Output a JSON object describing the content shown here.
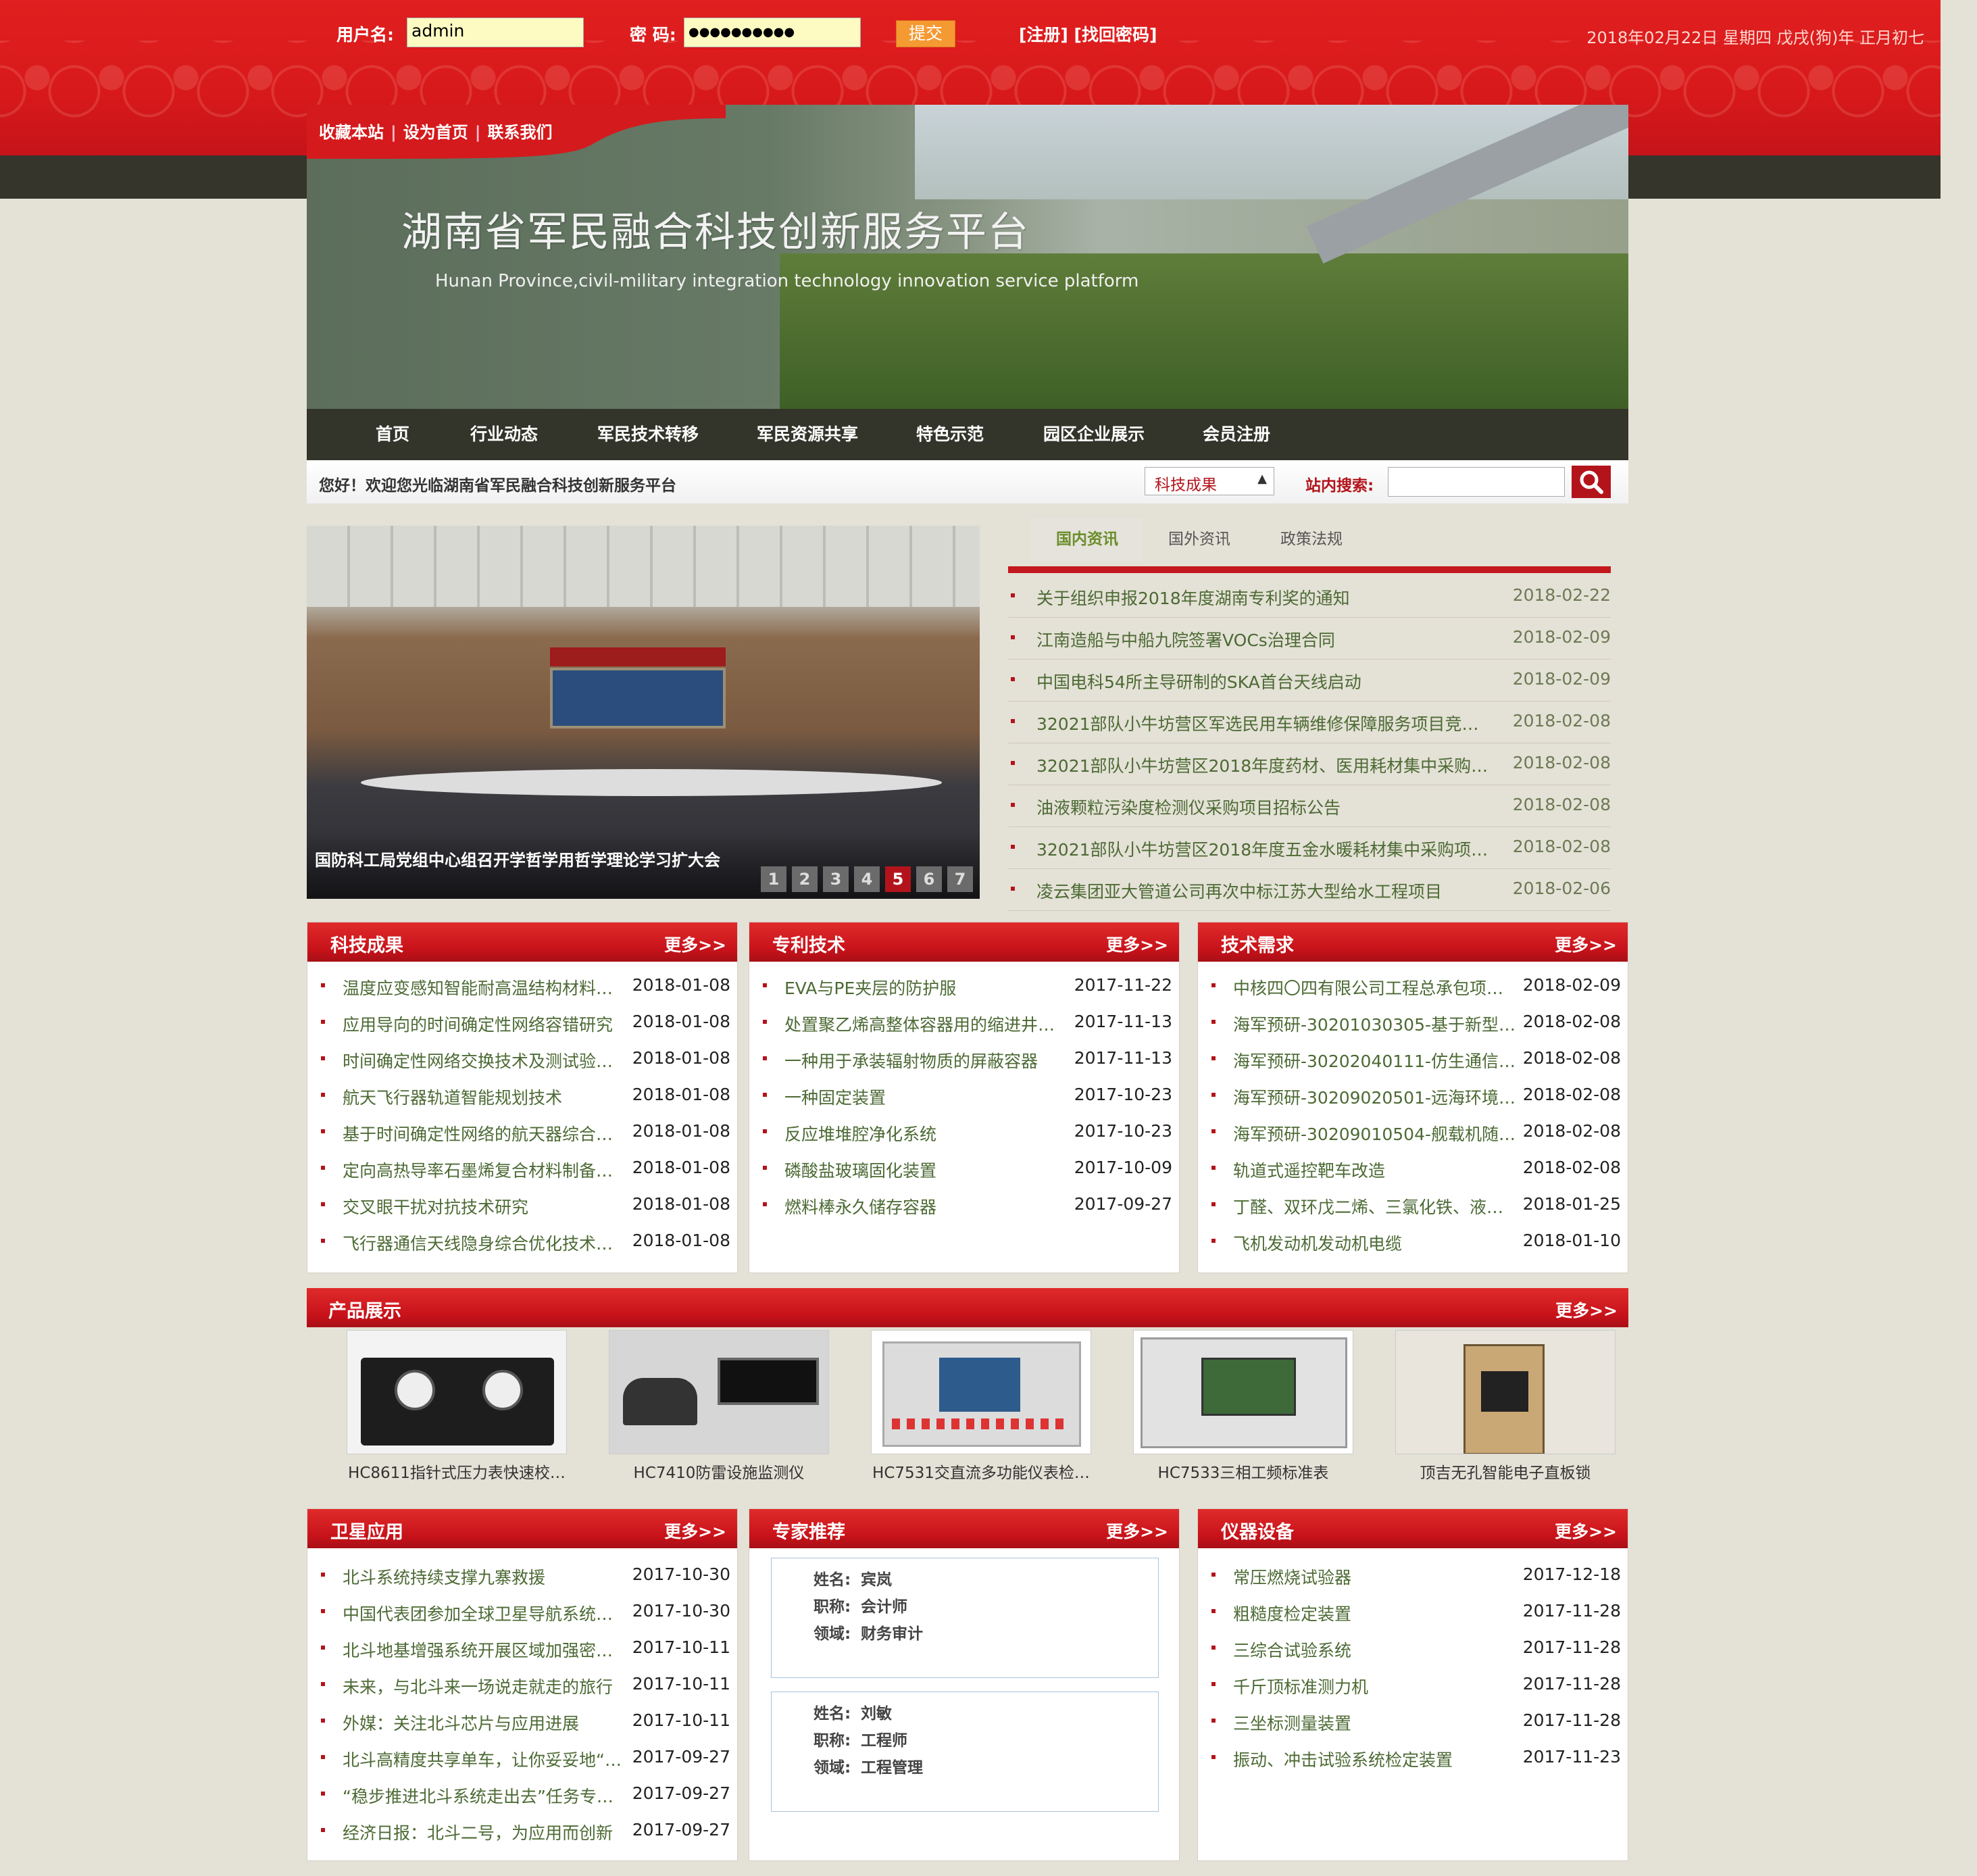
{
  "login": {
    "username_label": "用户名:",
    "username_value": "admin",
    "password_label": "密 码:",
    "password_value": "●●●●●●●●●●",
    "submit_label": "提交",
    "links": "[注册] [找回密码]",
    "date": "2018年02月22日 星期四 戊戌(狗)年 正月初七"
  },
  "toplinks": [
    "收藏本站",
    "设为首页",
    "联系我们"
  ],
  "banner": {
    "title": "湖南省军民融合科技创新服务平台",
    "subtitle": "Hunan Province,civil-military integration technology innovation service platform"
  },
  "nav": [
    "首页",
    "行业动态",
    "军民技术转移",
    "军民资源共享",
    "特色示范",
    "园区企业展示",
    "会员注册"
  ],
  "welcome": {
    "text": "您好！欢迎您光临湖南省军民融合科技创新服务平台",
    "select_value": "科技成果",
    "search_label": "站内搜索:"
  },
  "slideshow": {
    "caption": "国防科工局党组中心组召开学哲学用哲学理论学习扩大会",
    "pages": [
      "1",
      "2",
      "3",
      "4",
      "5",
      "6",
      "7"
    ],
    "active": 5
  },
  "news_tabs": [
    "国内资讯",
    "国外资讯",
    "政策法规"
  ],
  "news": [
    {
      "title": "关于组织申报2018年度湖南专利奖的通知",
      "date": "2018-02-22"
    },
    {
      "title": "江南造船与中船九院签署VOCs治理合同",
      "date": "2018-02-09"
    },
    {
      "title": "中国电科54所主导研制的SKA首台天线启动",
      "date": "2018-02-09"
    },
    {
      "title": "32021部队小牛坊营区军选民用车辆维修保障服务项目竞…",
      "date": "2018-02-08"
    },
    {
      "title": "32021部队小牛坊营区2018年度药材、医用耗材集中采购…",
      "date": "2018-02-08"
    },
    {
      "title": "油液颗粒污染度检测仪采购项目招标公告",
      "date": "2018-02-08"
    },
    {
      "title": "32021部队小牛坊营区2018年度五金水暖耗材集中采购项…",
      "date": "2018-02-08"
    },
    {
      "title": "凌云集团亚大管道公司再次中标江苏大型给水工程项目",
      "date": "2018-02-06"
    }
  ],
  "more_label": "更多>>",
  "kjcg": {
    "title": "科技成果",
    "items": [
      {
        "title": "温度应变感知智能耐高温结构材料…",
        "date": "2018-01-08"
      },
      {
        "title": "应用导向的时间确定性网络容错研究",
        "date": "2018-01-08"
      },
      {
        "title": "时间确定性网络交换技术及测试验…",
        "date": "2018-01-08"
      },
      {
        "title": "航天飞行器轨道智能规划技术",
        "date": "2018-01-08"
      },
      {
        "title": "基于时间确定性网络的航天器综合…",
        "date": "2018-01-08"
      },
      {
        "title": "定向高热导率石墨烯复合材料制备…",
        "date": "2018-01-08"
      },
      {
        "title": "交叉眼干扰对抗技术研究",
        "date": "2018-01-08"
      },
      {
        "title": "飞行器通信天线隐身综合优化技术…",
        "date": "2018-01-08"
      }
    ]
  },
  "zljs": {
    "title": "专利技术",
    "items": [
      {
        "title": "EVA与PE夹层的防护服",
        "date": "2017-11-22"
      },
      {
        "title": "处置聚乙烯高整体容器用的缩进井…",
        "date": "2017-11-13"
      },
      {
        "title": "一种用于承装辐射物质的屏蔽容器",
        "date": "2017-11-13"
      },
      {
        "title": "一种固定装置",
        "date": "2017-10-23"
      },
      {
        "title": "反应堆堆腔净化系统",
        "date": "2017-10-23"
      },
      {
        "title": "磷酸盐玻璃固化装置",
        "date": "2017-10-09"
      },
      {
        "title": "燃料棒永久储存容器",
        "date": "2017-09-27"
      }
    ]
  },
  "jsxq": {
    "title": "技术需求",
    "items": [
      {
        "title": "中核四〇四有限公司工程总承包项…",
        "date": "2018-02-09"
      },
      {
        "title": "海军预研-30201030305-基于新型…",
        "date": "2018-02-08"
      },
      {
        "title": "海军预研-30202040111-仿生通信…",
        "date": "2018-02-08"
      },
      {
        "title": "海军预研-30209020501-远海环境…",
        "date": "2018-02-08"
      },
      {
        "title": "海军预研-30209010504-舰载机随…",
        "date": "2018-02-08"
      },
      {
        "title": "轨道式遥控靶车改造",
        "date": "2018-02-08"
      },
      {
        "title": "丁醛、双环戊二烯、三氯化铁、液…",
        "date": "2018-01-25"
      },
      {
        "title": "飞机发动机发动机电缆",
        "date": "2018-01-10"
      }
    ]
  },
  "products": {
    "title": "产品展示",
    "items": [
      "HC8611指针式压力表快速校…",
      "HC7410防雷设施监测仪",
      "HC7531交直流多功能仪表检…",
      "HC7533三相工频标准表",
      "顶吉无孔智能电子直板锁"
    ]
  },
  "wxyy": {
    "title": "卫星应用",
    "items": [
      {
        "title": "北斗系统持续支撑九寨救援",
        "date": "2017-10-30"
      },
      {
        "title": "中国代表团参加全球卫星导航系统…",
        "date": "2017-10-30"
      },
      {
        "title": "北斗地基增强系统开展区域加强密…",
        "date": "2017-10-11"
      },
      {
        "title": "未来，与北斗来一场说走就走的旅行",
        "date": "2017-10-11"
      },
      {
        "title": "外媒：关注北斗芯片与应用进展",
        "date": "2017-10-11"
      },
      {
        "title": "北斗高精度共享单车，让你妥妥地“…",
        "date": "2017-09-27"
      },
      {
        "title": "“稳步推进北斗系统走出去”任务专…",
        "date": "2017-09-27"
      },
      {
        "title": "经济日报：北斗二号，为应用而创新",
        "date": "2017-09-27"
      }
    ]
  },
  "zjtj": {
    "title": "专家推荐",
    "labels": {
      "name": "姓名:",
      "title": "职称:",
      "field": "领域:"
    },
    "experts": [
      {
        "name": "宾岚",
        "title": "会计师",
        "field": "财务审计"
      },
      {
        "name": "刘敏",
        "title": "工程师",
        "field": "工程管理"
      }
    ]
  },
  "yqsb": {
    "title": "仪器设备",
    "items": [
      {
        "title": "常压燃烧试验器",
        "date": "2017-12-18"
      },
      {
        "title": "粗糙度检定装置",
        "date": "2017-11-28"
      },
      {
        "title": "三综合试验系统",
        "date": "2017-11-28"
      },
      {
        "title": "千斤顶标准测力机",
        "date": "2017-11-28"
      },
      {
        "title": "三坐标测量装置",
        "date": "2017-11-28"
      },
      {
        "title": "振动、冲击试验系统检定装置",
        "date": "2017-11-23"
      }
    ]
  },
  "colors": {
    "brand_red": "#c7121a",
    "dark_band": "#35352b",
    "link_green": "#4c6a34",
    "accent_orange": "#f59a33"
  }
}
